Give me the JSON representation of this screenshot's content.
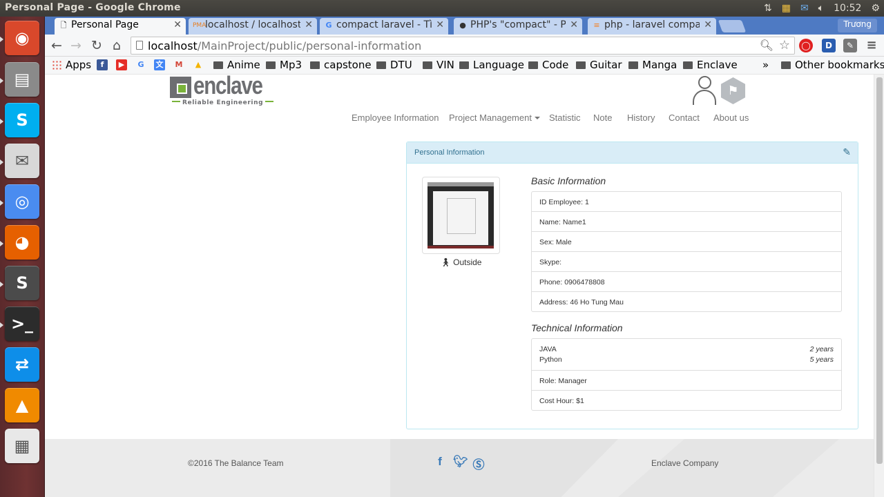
{
  "window": {
    "title": "Personal Page - Google Chrome"
  },
  "panel_indicators": {
    "clock": "10:52"
  },
  "launcher": {
    "apps": [
      {
        "name": "ubuntu-dash",
        "color": "#d9482b",
        "glyph": "◉"
      },
      {
        "name": "files",
        "color": "#8a8a8a",
        "glyph": "▤"
      },
      {
        "name": "skype",
        "color": "#00aff0",
        "glyph": "S"
      },
      {
        "name": "mail",
        "color": "#d8d8d8",
        "glyph": "✉"
      },
      {
        "name": "chrome",
        "color": "#4a8cf0",
        "glyph": "◎"
      },
      {
        "name": "firefox",
        "color": "#e66000",
        "glyph": "◕"
      },
      {
        "name": "sublime-text",
        "color": "#4b4b4b",
        "glyph": "S"
      },
      {
        "name": "terminal",
        "color": "#2c2c2c",
        "glyph": ">_"
      },
      {
        "name": "teamviewer",
        "color": "#0e8ee9",
        "glyph": "⇄"
      },
      {
        "name": "vlc",
        "color": "#f08a00",
        "glyph": "▲"
      },
      {
        "name": "libreoffice-stack",
        "color": "#e8e8e8",
        "glyph": "▦"
      }
    ]
  },
  "browser": {
    "tabs": [
      {
        "label": "Personal Page",
        "icon": "page-icon",
        "active": true
      },
      {
        "label": "localhost / localhost",
        "icon": "phpmyadmin-icon",
        "active": false
      },
      {
        "label": "compact laravel - Tìm",
        "icon": "google-icon",
        "active": false
      },
      {
        "label": "PHP's \"compact\" - Pr",
        "icon": "dot-icon",
        "active": false
      },
      {
        "label": "php - laravel compac",
        "icon": "stackoverflow-icon",
        "active": false
      }
    ],
    "profile": "Trương",
    "url_host": "localhost",
    "url_path": "/MainProject/public/personal-information",
    "bookmarks": {
      "apps_label": "Apps",
      "folders": [
        "Anime",
        "Mp3",
        "capstone",
        "DTU",
        "VIN",
        "Language",
        "Code",
        "Guitar",
        "Manga",
        "Enclave"
      ],
      "overflow": "»",
      "other": "Other bookmarks"
    }
  },
  "site": {
    "logo": {
      "word": "enclave",
      "tagline": "Reliable Engineering"
    },
    "nav": [
      "Employee Information",
      "Project Management",
      "Statistic",
      "Note",
      "History",
      "Contact",
      "About us"
    ],
    "panel": {
      "title": "Personal Information",
      "location": "Outside",
      "basic_title": "Basic Information",
      "basic": [
        "ID Employee: 1",
        "Name: Name1",
        "Sex: Male",
        "Skype:",
        "Phone: 0906478808",
        "Address: 46 Ho Tung Mau"
      ],
      "technical_title": "Technical Information",
      "skills": [
        {
          "name": "JAVA",
          "years": "2 years"
        },
        {
          "name": "Python",
          "years": "5 years"
        }
      ],
      "role": "Role: Manager",
      "cost": "Cost Hour: $1"
    },
    "footer": {
      "copyright": "©2016 The Balance Team",
      "company": "Enclave Company",
      "social": [
        "facebook-icon",
        "twitter-icon",
        "skype-icon"
      ]
    }
  }
}
